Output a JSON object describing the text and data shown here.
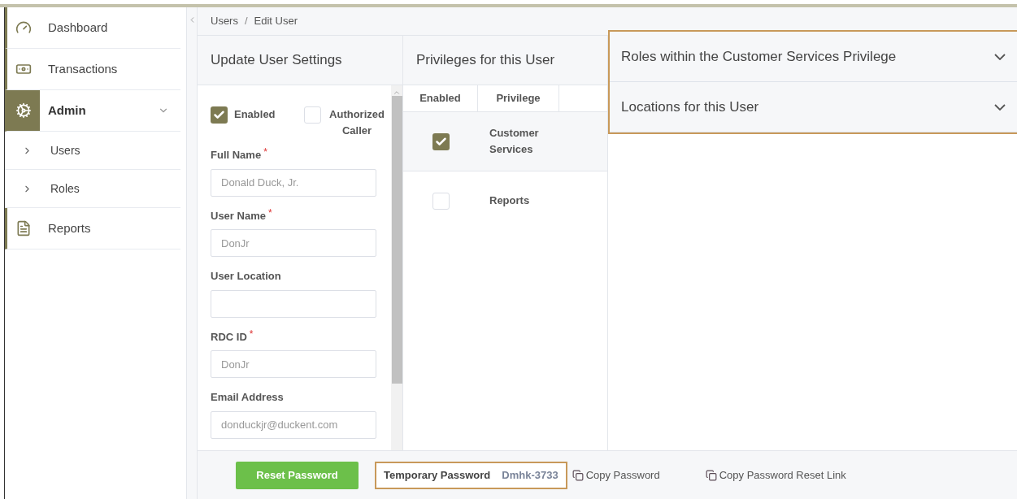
{
  "sidebar": {
    "items": [
      {
        "label": "Dashboard",
        "selected": false
      },
      {
        "label": "Transactions",
        "selected": false
      },
      {
        "label": "Admin",
        "selected": true,
        "expanded": true,
        "children": [
          {
            "label": "Users"
          },
          {
            "label": "Roles"
          }
        ]
      },
      {
        "label": "Reports",
        "selected": false
      }
    ]
  },
  "breadcrumb": {
    "items": [
      "Users",
      "Edit User"
    ],
    "separator": "/"
  },
  "settings": {
    "title": "Update User Settings",
    "checkboxes": [
      {
        "label": "Enabled",
        "checked": true
      },
      {
        "label": "Authorized Caller",
        "checked": false
      }
    ],
    "fields": [
      {
        "label": "Full Name",
        "required_mark": "*",
        "value": "Donald Duck, Jr."
      },
      {
        "label": "User Name",
        "required_mark": "*",
        "value": "DonJr"
      },
      {
        "label": "User Location"
      },
      {
        "label": "RDC ID",
        "required_mark": "*",
        "value": "DonJr"
      },
      {
        "label": "Email Address",
        "value": "donduckjr@duckent.com"
      }
    ]
  },
  "privileges": {
    "title": "Privileges for this User",
    "columns": [
      "Enabled",
      "Privilege"
    ],
    "rows": [
      {
        "enabled": true,
        "privilege": "Customer Services",
        "selected": true
      },
      {
        "enabled": false,
        "privilege": "Reports",
        "selected": false
      }
    ]
  },
  "accordions": [
    {
      "title": "Roles within the Customer Services Privilege",
      "expanded": false
    },
    {
      "title": "Locations for this User",
      "expanded": false
    }
  ],
  "footer": {
    "reset_button": "Reset Password",
    "temp_password_label": "Temporary Password",
    "temp_password": "Dmhk-3733",
    "links": [
      "Copy Password",
      "Copy Password Reset Link"
    ]
  }
}
